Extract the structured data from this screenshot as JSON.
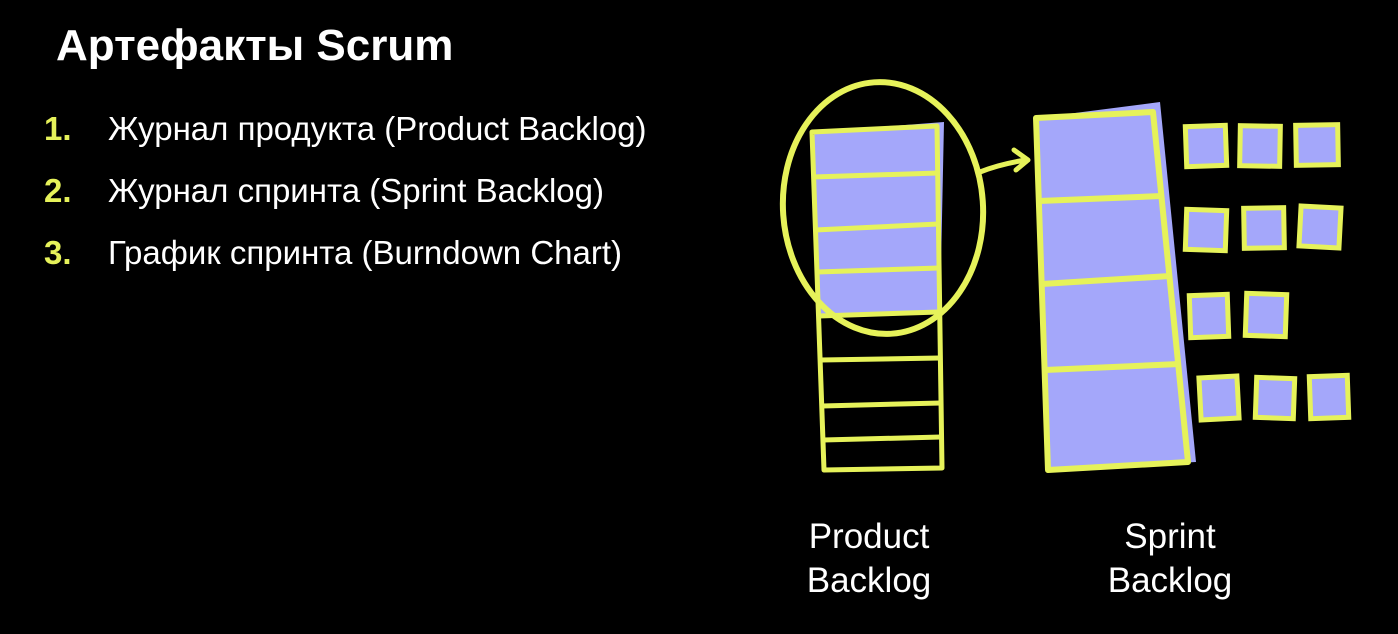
{
  "slide": {
    "title": "Артефакты Scrum"
  },
  "artifacts": [
    {
      "number": "1.",
      "text": "Журнал продукта (Product Backlog)"
    },
    {
      "number": "2.",
      "text": "Журнал спринта (Sprint Backlog)"
    },
    {
      "number": "3.",
      "text": "График спринта (Burndown Chart)"
    }
  ],
  "diagram": {
    "product_backlog_label": "Product Backlog",
    "sprint_backlog_label": "Sprint Backlog",
    "colors": {
      "outline": "#e6f25a",
      "fill": "#a4a7fa",
      "background": "#000000"
    }
  }
}
